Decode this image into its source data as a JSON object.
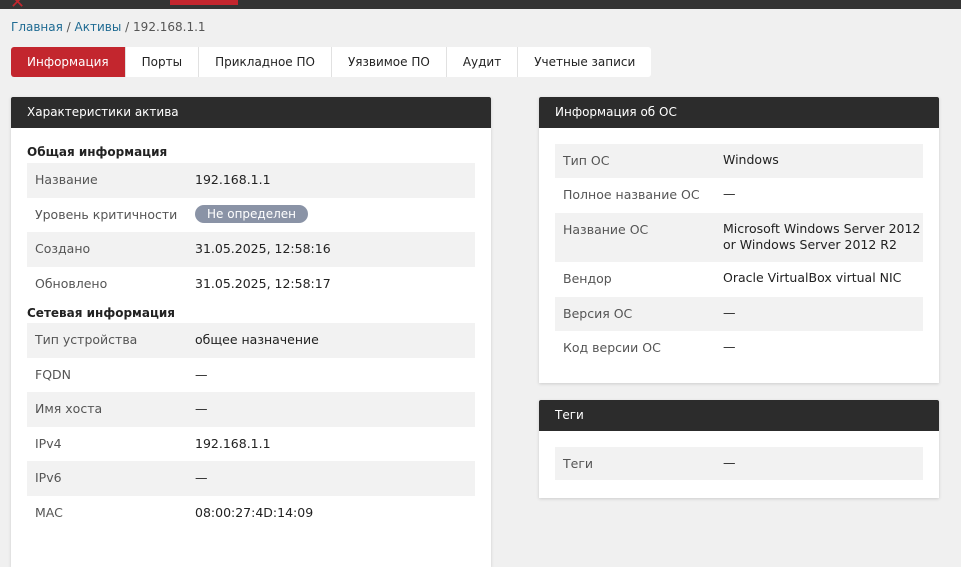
{
  "breadcrumb": {
    "home": "Главная",
    "assets": "Активы",
    "sep": "/",
    "current": "192.168.1.1"
  },
  "tabs": [
    {
      "label": "Информация",
      "active": true
    },
    {
      "label": "Порты"
    },
    {
      "label": "Прикладное ПО"
    },
    {
      "label": "Уязвимое ПО"
    },
    {
      "label": "Аудит"
    },
    {
      "label": "Учетные записи"
    }
  ],
  "asset_card": {
    "title": "Характеристики актива",
    "general_title": "Общая информация",
    "general": [
      {
        "label": "Название",
        "value": "192.168.1.1"
      },
      {
        "label": "Уровень критичности",
        "value": "Не определен"
      },
      {
        "label": "Создано",
        "value": "31.05.2025, 12:58:16"
      },
      {
        "label": "Обновлено",
        "value": "31.05.2025, 12:58:17"
      }
    ],
    "network_title": "Сетевая информация",
    "network": [
      {
        "label": "Тип устройства",
        "value": "общее назначение"
      },
      {
        "label": "FQDN",
        "value": "—"
      },
      {
        "label": "Имя хоста",
        "value": "—"
      },
      {
        "label": "IPv4",
        "value": "192.168.1.1"
      },
      {
        "label": "IPv6",
        "value": "—"
      },
      {
        "label": "MAC",
        "value": "08:00:27:4D:14:09"
      }
    ]
  },
  "os_card": {
    "title": "Информация об ОС",
    "rows": [
      {
        "label": "Тип ОС",
        "value": "Windows"
      },
      {
        "label": "Полное название ОС",
        "value": "—"
      },
      {
        "label": "Название ОС",
        "value": "Microsoft Windows Server 2012 or Windows Server 2012 R2"
      },
      {
        "label": "Вендор",
        "value": "Oracle VirtualBox virtual NIC"
      },
      {
        "label": "Версия ОС",
        "value": "—"
      },
      {
        "label": "Код версии ОС",
        "value": "—"
      }
    ]
  },
  "tags_card": {
    "title": "Теги",
    "rows": [
      {
        "label": "Теги",
        "value": "—"
      }
    ]
  },
  "colors": {
    "accent": "#c3262e",
    "header": "#2c2c2c",
    "badge": "#8a93a6",
    "link": "#1f6b93"
  }
}
